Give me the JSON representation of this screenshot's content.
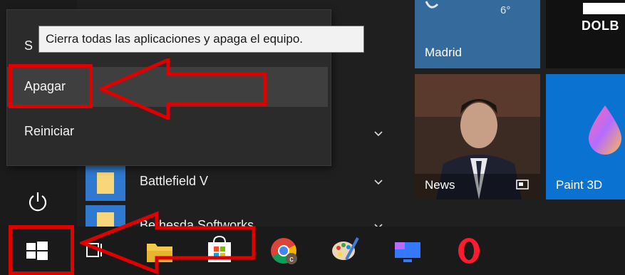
{
  "tooltip": {
    "text": "Cierra todas las aplicaciones y apaga el equipo."
  },
  "power_menu": {
    "partial_label": "S",
    "items": [
      {
        "label": "Apagar"
      },
      {
        "label": "Reiniciar"
      }
    ]
  },
  "app_list": {
    "items": [
      {
        "label": "Battlefield V"
      },
      {
        "label": "Bethesda Softworks"
      }
    ]
  },
  "tiles": {
    "weather": {
      "city": "Madrid",
      "temp": "6°"
    },
    "news": {
      "label": "News"
    },
    "paint3d": {
      "label": "Paint 3D"
    },
    "dolby": {
      "label": "DOLB"
    }
  },
  "colors": {
    "accent_tile": "#2d6eb0",
    "weather_tile": "#356a9c",
    "paint_tile": "#0a72d1",
    "annotation": "#e00000"
  },
  "taskbar": {
    "icons": [
      "windows-start-icon",
      "task-view-icon",
      "file-explorer-icon",
      "microsoft-store-icon",
      "chrome-icon",
      "paint-icon",
      "remote-desktop-icon",
      "opera-icon"
    ]
  }
}
